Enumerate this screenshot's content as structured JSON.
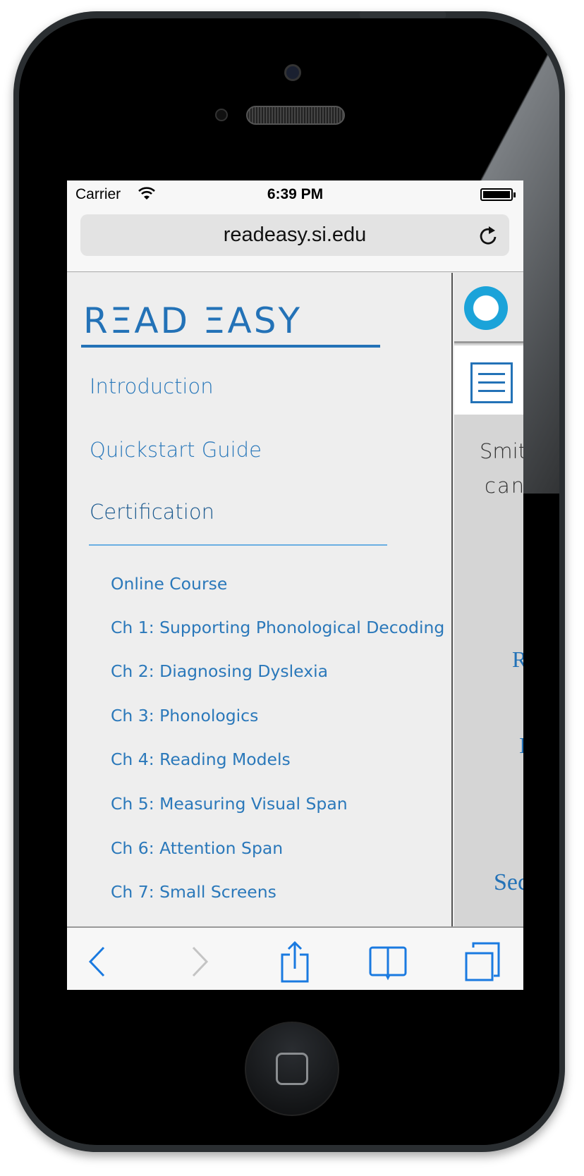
{
  "status_bar": {
    "carrier": "Carrier",
    "time": "6:39 PM"
  },
  "browser": {
    "url": "readeasy.si.edu"
  },
  "sidebar": {
    "logo": "RΞAD ΞASY",
    "items": [
      {
        "label": "Introduction"
      },
      {
        "label": "Quickstart Guide"
      },
      {
        "label": "Certification"
      }
    ],
    "subitems": [
      {
        "label": "Online Course"
      },
      {
        "label": "Ch 1: Supporting Phonological Decoding"
      },
      {
        "label": "Ch 2: Diagnosing Dyslexia"
      },
      {
        "label": "Ch 3: Phonologics"
      },
      {
        "label": "Ch 4: Reading Models"
      },
      {
        "label": "Ch 5: Measuring Visual Span"
      },
      {
        "label": "Ch 6: Attention Span"
      },
      {
        "label": "Ch 7: Small Screens"
      }
    ]
  },
  "content": {
    "line1": "Smit",
    "line2": "can",
    "link1": "R",
    "link2": "I",
    "link3": "Sec"
  },
  "colors": {
    "accent": "#2372b7",
    "active": "#1c5a8f",
    "ios_blue": "#1a7ae0"
  }
}
